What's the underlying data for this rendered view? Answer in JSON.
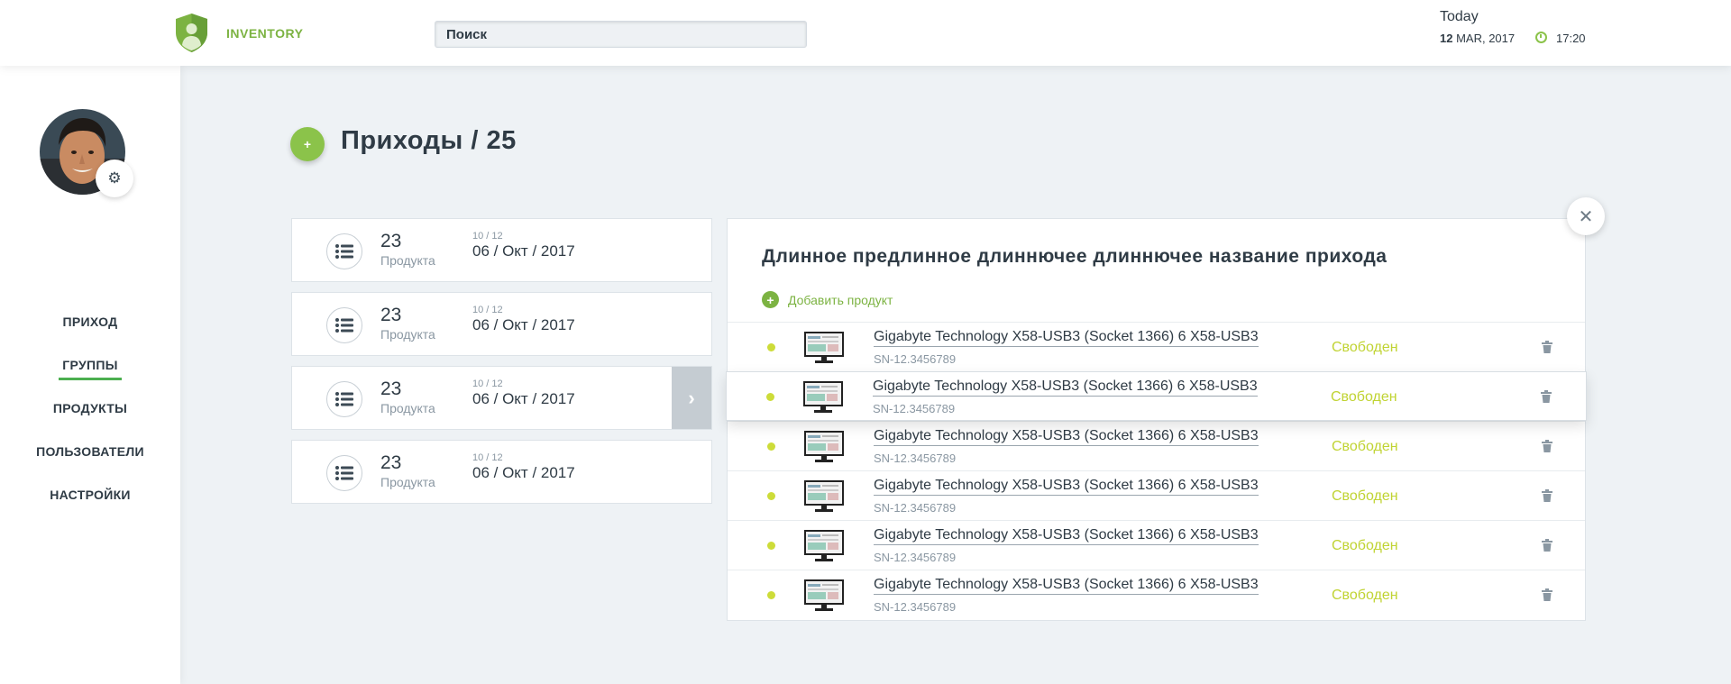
{
  "header": {
    "brand": "INVENTORY",
    "search_placeholder": "Поиск",
    "today_label": "Today",
    "date_day": "12",
    "date_rest": "MAR, 2017",
    "time": "17:20"
  },
  "sidebar": {
    "items": [
      {
        "label": "ПРИХОД"
      },
      {
        "label": "ГРУППЫ"
      },
      {
        "label": "ПРОДУКТЫ"
      },
      {
        "label": "ПОЛЬЗОВАТЕЛИ"
      },
      {
        "label": "НАСТРОЙКИ"
      }
    ],
    "active_index": 1
  },
  "main": {
    "add_button": "+",
    "title": "Приходы / 25",
    "receipts": [
      {
        "count": "23",
        "unit": "Продукта",
        "small_date": "10 / 12",
        "date": "06 / Окт / 2017"
      },
      {
        "count": "23",
        "unit": "Продукта",
        "small_date": "10 / 12",
        "date": "06 / Окт / 2017"
      },
      {
        "count": "23",
        "unit": "Продукта",
        "small_date": "10 / 12",
        "date": "06 / Окт / 2017"
      },
      {
        "count": "23",
        "unit": "Продукта",
        "small_date": "10 / 12",
        "date": "06 / Окт / 2017"
      }
    ],
    "selected_receipt": 2
  },
  "detail": {
    "title": "Длинное предлинное длиннючее длиннючее название прихода",
    "add_product": "Добавить продукт",
    "products": [
      {
        "name": "Gigabyte Technology X58-USB3 (Socket 1366) 6 X58-USB3",
        "sn": "SN-12.3456789",
        "status": "Свободен"
      },
      {
        "name": "Gigabyte Technology X58-USB3 (Socket 1366) 6 X58-USB3",
        "sn": "SN-12.3456789",
        "status": "Свободен"
      },
      {
        "name": "Gigabyte Technology X58-USB3 (Socket 1366) 6 X58-USB3",
        "sn": "SN-12.3456789",
        "status": "Свободен"
      },
      {
        "name": "Gigabyte Technology X58-USB3 (Socket 1366) 6 X58-USB3",
        "sn": "SN-12.3456789",
        "status": "Свободен"
      },
      {
        "name": "Gigabyte Technology X58-USB3 (Socket 1366) 6 X58-USB3",
        "sn": "SN-12.3456789",
        "status": "Свободен"
      },
      {
        "name": "Gigabyte Technology X58-USB3 (Socket 1366) 6 X58-USB3",
        "sn": "SN-12.3456789",
        "status": "Свободен"
      }
    ],
    "highlighted_row": 1
  },
  "colors": {
    "accent_green": "#7cb342",
    "status_yellow_green": "#c0d332",
    "dot": "#cddc39"
  }
}
